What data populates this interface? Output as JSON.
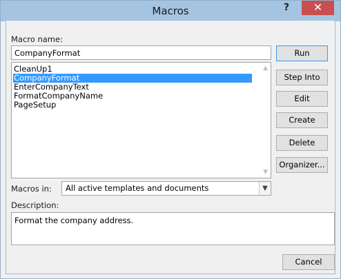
{
  "window": {
    "title": "Macros",
    "help_label": "?",
    "close_label": "✕"
  },
  "macro_name": {
    "label": "Macro name:",
    "value": "CompanyFormat"
  },
  "macro_list": {
    "items": [
      "CleanUp1",
      "CompanyFormat",
      "EnterCompanyText",
      "FormatCompanyName",
      "PageSetup"
    ],
    "selected": "CompanyFormat"
  },
  "buttons": {
    "run": "Run",
    "step_into": "Step Into",
    "edit": "Edit",
    "create": "Create",
    "delete": "Delete",
    "organizer": "Organizer...",
    "cancel": "Cancel"
  },
  "macros_in": {
    "label": "Macros in:",
    "value": "All active templates and documents"
  },
  "description": {
    "label": "Description:",
    "value": "Format the company address."
  },
  "colors": {
    "titlebar": "#a5c4e2",
    "close_button": "#c7504f",
    "selection": "#3399ff"
  }
}
